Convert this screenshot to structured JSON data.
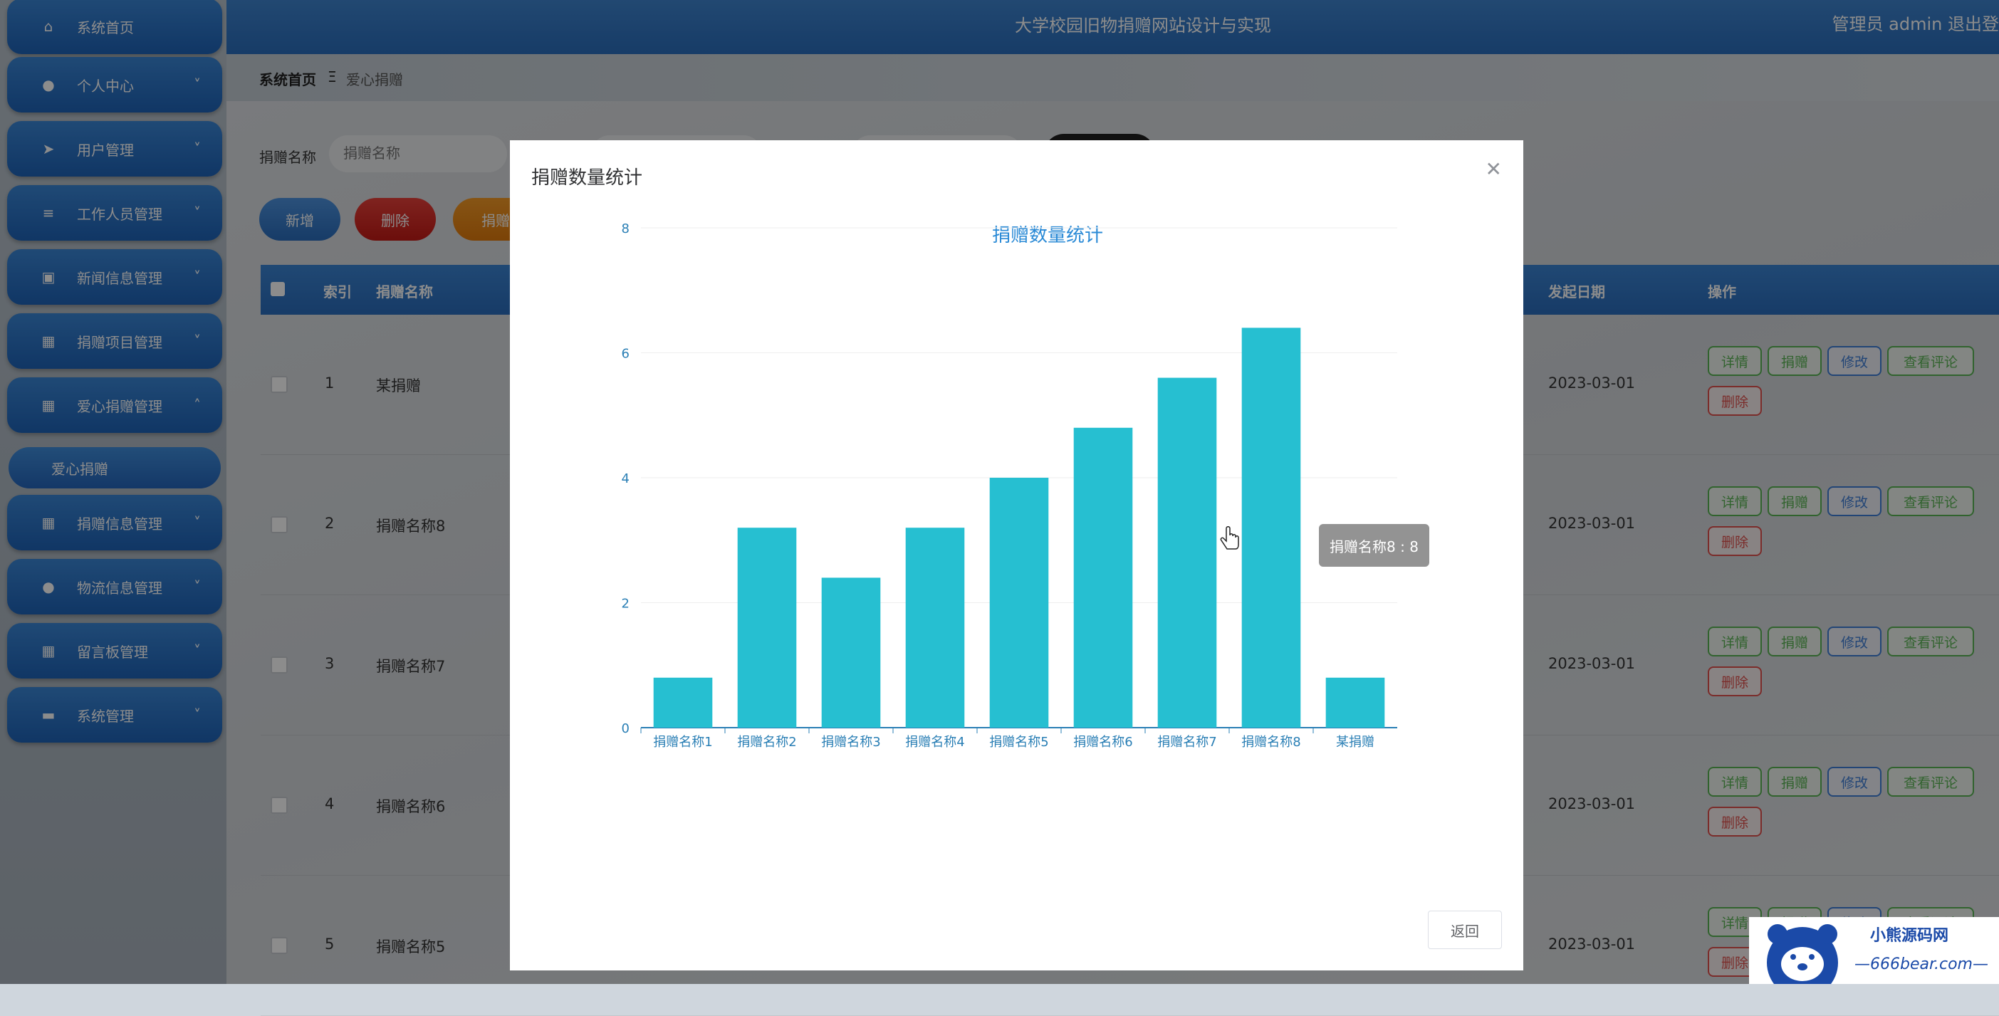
{
  "app": {
    "title": "大学校园旧物捐赠网站设计与实现",
    "user": "管理员 admin  退出登"
  },
  "sidebar": {
    "items": [
      {
        "label": "系统首页",
        "icon": "home-icon"
      },
      {
        "label": "个人中心",
        "icon": "user-icon"
      },
      {
        "label": "用户管理",
        "icon": "send-icon"
      },
      {
        "label": "工作人员管理",
        "icon": "sliders-icon"
      },
      {
        "label": "新闻信息管理",
        "icon": "clipboard-icon"
      },
      {
        "label": "捐赠项目管理",
        "icon": "grid-icon"
      },
      {
        "label": "爱心捐赠管理",
        "icon": "grid-icon"
      },
      {
        "label": "捐赠信息管理",
        "icon": "grid-icon"
      },
      {
        "label": "物流信息管理",
        "icon": "user-icon"
      },
      {
        "label": "留言板管理",
        "icon": "grid-icon"
      },
      {
        "label": "系统管理",
        "icon": "chat-icon"
      }
    ],
    "sub_item": "爱心捐赠"
  },
  "breadcrumb": {
    "home": "系统首页",
    "separator": "Ξ",
    "current": "爱心捐赠"
  },
  "search": {
    "label": "捐赠名称",
    "placeholder": "捐赠名称"
  },
  "buttons": {
    "add": "新增",
    "delete": "删除",
    "stats": "捐赠"
  },
  "table": {
    "headers": {
      "index": "索引",
      "name": "捐赠名称",
      "date": "发起日期",
      "ops": "操作"
    },
    "rows": [
      {
        "index": "1",
        "name": "某捐赠",
        "date": "2023-03-01"
      },
      {
        "index": "2",
        "name": "捐赠名称8",
        "date": "2023-03-01"
      },
      {
        "index": "3",
        "name": "捐赠名称7",
        "date": "2023-03-01"
      },
      {
        "index": "4",
        "name": "捐赠名称6",
        "date": "2023-03-01"
      },
      {
        "index": "5",
        "name": "捐赠名称5",
        "date": "2023-03-01"
      }
    ],
    "ops": {
      "detail": "详情",
      "donate": "捐赠",
      "edit": "修改",
      "comments": "查看评论",
      "delete": "删除"
    }
  },
  "modal": {
    "title": "捐赠数量统计",
    "back": "返回"
  },
  "tooltip": {
    "text": "捐赠名称8 : 8"
  },
  "watermark": {
    "brand": "小熊源码网",
    "url": "—666bear.com—"
  },
  "colors": {
    "bar": "#26bfd1",
    "primary": "#2a6dbc",
    "axis": "#2a7fb5"
  },
  "chart_data": {
    "type": "bar",
    "title": "捐赠数量统计",
    "categories": [
      "捐赠名称1",
      "捐赠名称2",
      "捐赠名称3",
      "捐赠名称4",
      "捐赠名称5",
      "捐赠名称6",
      "捐赠名称7",
      "捐赠名称8",
      "某捐赠"
    ],
    "values": [
      0.8,
      3.2,
      2.4,
      3.2,
      4,
      4.8,
      5.6,
      6.4,
      0.8
    ],
    "yticks": [
      "0",
      "2",
      "4",
      "6",
      "8"
    ],
    "ylim": [
      0,
      8
    ],
    "grid": true
  }
}
